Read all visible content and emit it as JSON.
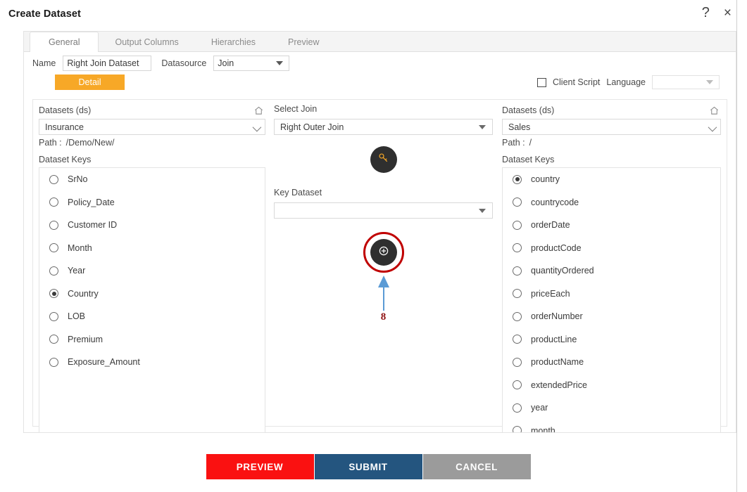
{
  "window": {
    "title": "Create Dataset",
    "help_icon": "?",
    "close_icon": "×"
  },
  "tabs": [
    {
      "label": "General",
      "active": true
    },
    {
      "label": "Output Columns",
      "active": false
    },
    {
      "label": "Hierarchies",
      "active": false
    },
    {
      "label": "Preview",
      "active": false
    }
  ],
  "form": {
    "name_label": "Name",
    "name_value": "Right Join Dataset",
    "datasource_label": "Datasource",
    "datasource_value": "Join"
  },
  "detail": {
    "tab_label": "Detail",
    "client_script_label": "Client Script",
    "client_script_checked": false,
    "language_label": "Language",
    "language_value": ""
  },
  "left_panel": {
    "heading": "Datasets (ds)",
    "home_icon": "home-icon",
    "dataset_value": "Insurance",
    "path_label": "Path :",
    "path_value": "/Demo/New/",
    "keys_label": "Dataset Keys",
    "keys": [
      {
        "label": "SrNo",
        "selected": false
      },
      {
        "label": "Policy_Date",
        "selected": false
      },
      {
        "label": "Customer ID",
        "selected": false
      },
      {
        "label": "Month",
        "selected": false
      },
      {
        "label": "Year",
        "selected": false
      },
      {
        "label": "Country",
        "selected": true
      },
      {
        "label": "LOB",
        "selected": false
      },
      {
        "label": "Premium",
        "selected": false
      },
      {
        "label": "Exposure_Amount",
        "selected": false
      }
    ]
  },
  "middle_panel": {
    "select_join_label": "Select Join",
    "select_join_value": "Right Outer Join",
    "key_icon": "key-icon",
    "key_dataset_label": "Key Dataset",
    "key_dataset_value": "",
    "add_icon": "plus-circle-icon",
    "annotation_number": "8"
  },
  "right_panel": {
    "heading": "Datasets (ds)",
    "home_icon": "home-icon",
    "dataset_value": "Sales",
    "path_label": "Path :",
    "path_value": "/",
    "keys_label": "Dataset Keys",
    "keys": [
      {
        "label": "country",
        "selected": true
      },
      {
        "label": "countrycode",
        "selected": false
      },
      {
        "label": "orderDate",
        "selected": false
      },
      {
        "label": "productCode",
        "selected": false
      },
      {
        "label": "quantityOrdered",
        "selected": false
      },
      {
        "label": "priceEach",
        "selected": false
      },
      {
        "label": "orderNumber",
        "selected": false
      },
      {
        "label": "productLine",
        "selected": false
      },
      {
        "label": "productName",
        "selected": false
      },
      {
        "label": "extendedPrice",
        "selected": false
      },
      {
        "label": "year",
        "selected": false
      },
      {
        "label": "month",
        "selected": false
      }
    ]
  },
  "footer": {
    "preview_label": "PREVIEW",
    "submit_label": "SUBMIT",
    "cancel_label": "CANCEL"
  },
  "colors": {
    "detail_tab": "#f7a827",
    "preview_button": "#fa1111",
    "submit_button": "#24557f",
    "cancel_button": "#9b9b9b",
    "annotation_ring": "#c00000",
    "annotation_arrow": "#5b9bd5",
    "key_icon": "#f7a827"
  }
}
